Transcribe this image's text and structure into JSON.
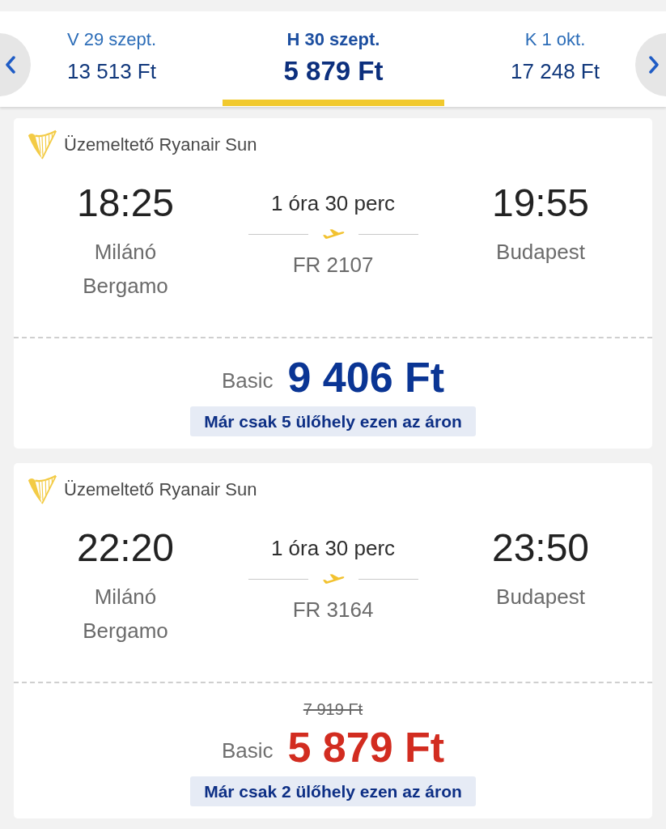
{
  "date_tabs": [
    {
      "day": "V 29 szept.",
      "price": "13 513 Ft",
      "selected": false
    },
    {
      "day": "H 30 szept.",
      "price": "5 879 Ft",
      "selected": true
    },
    {
      "day": "K 1 okt.",
      "price": "17 248 Ft",
      "selected": false
    }
  ],
  "flights": [
    {
      "operator": "Üzemeltető Ryanair Sun",
      "departure_time": "18:25",
      "departure_airport": "Milánó Bergamo",
      "duration": "1 óra 30 perc",
      "flight_number": "FR 2107",
      "arrival_time": "19:55",
      "arrival_airport": "Budapest",
      "fare": "Basic",
      "price": "9 406 Ft",
      "discounted": false,
      "seats_note": "Már csak 5 ülőhely ezen az áron"
    },
    {
      "operator": "Üzemeltető Ryanair Sun",
      "departure_time": "22:20",
      "departure_airport": "Milánó Bergamo",
      "duration": "1 óra 30 perc",
      "flight_number": "FR 3164",
      "arrival_time": "23:50",
      "arrival_airport": "Budapest",
      "fare": "Basic",
      "old_price": "7 919 Ft",
      "price": "5 879 Ft",
      "discounted": true,
      "seats_note": "Már csak 2 ülőhely ezen az áron"
    }
  ]
}
